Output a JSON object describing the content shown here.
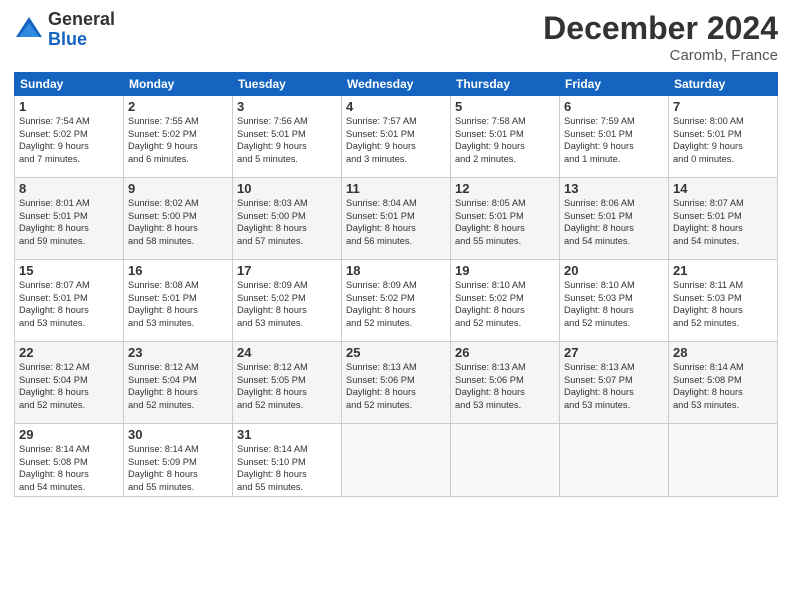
{
  "logo": {
    "general": "General",
    "blue": "Blue"
  },
  "header": {
    "month": "December 2024",
    "location": "Caromb, France"
  },
  "days": [
    "Sunday",
    "Monday",
    "Tuesday",
    "Wednesday",
    "Thursday",
    "Friday",
    "Saturday"
  ],
  "rows": [
    [
      {
        "num": "1",
        "lines": [
          "Sunrise: 7:54 AM",
          "Sunset: 5:02 PM",
          "Daylight: 9 hours",
          "and 7 minutes."
        ]
      },
      {
        "num": "2",
        "lines": [
          "Sunrise: 7:55 AM",
          "Sunset: 5:02 PM",
          "Daylight: 9 hours",
          "and 6 minutes."
        ]
      },
      {
        "num": "3",
        "lines": [
          "Sunrise: 7:56 AM",
          "Sunset: 5:01 PM",
          "Daylight: 9 hours",
          "and 5 minutes."
        ]
      },
      {
        "num": "4",
        "lines": [
          "Sunrise: 7:57 AM",
          "Sunset: 5:01 PM",
          "Daylight: 9 hours",
          "and 3 minutes."
        ]
      },
      {
        "num": "5",
        "lines": [
          "Sunrise: 7:58 AM",
          "Sunset: 5:01 PM",
          "Daylight: 9 hours",
          "and 2 minutes."
        ]
      },
      {
        "num": "6",
        "lines": [
          "Sunrise: 7:59 AM",
          "Sunset: 5:01 PM",
          "Daylight: 9 hours",
          "and 1 minute."
        ]
      },
      {
        "num": "7",
        "lines": [
          "Sunrise: 8:00 AM",
          "Sunset: 5:01 PM",
          "Daylight: 9 hours",
          "and 0 minutes."
        ]
      }
    ],
    [
      {
        "num": "8",
        "lines": [
          "Sunrise: 8:01 AM",
          "Sunset: 5:01 PM",
          "Daylight: 8 hours",
          "and 59 minutes."
        ]
      },
      {
        "num": "9",
        "lines": [
          "Sunrise: 8:02 AM",
          "Sunset: 5:00 PM",
          "Daylight: 8 hours",
          "and 58 minutes."
        ]
      },
      {
        "num": "10",
        "lines": [
          "Sunrise: 8:03 AM",
          "Sunset: 5:00 PM",
          "Daylight: 8 hours",
          "and 57 minutes."
        ]
      },
      {
        "num": "11",
        "lines": [
          "Sunrise: 8:04 AM",
          "Sunset: 5:01 PM",
          "Daylight: 8 hours",
          "and 56 minutes."
        ]
      },
      {
        "num": "12",
        "lines": [
          "Sunrise: 8:05 AM",
          "Sunset: 5:01 PM",
          "Daylight: 8 hours",
          "and 55 minutes."
        ]
      },
      {
        "num": "13",
        "lines": [
          "Sunrise: 8:06 AM",
          "Sunset: 5:01 PM",
          "Daylight: 8 hours",
          "and 54 minutes."
        ]
      },
      {
        "num": "14",
        "lines": [
          "Sunrise: 8:07 AM",
          "Sunset: 5:01 PM",
          "Daylight: 8 hours",
          "and 54 minutes."
        ]
      }
    ],
    [
      {
        "num": "15",
        "lines": [
          "Sunrise: 8:07 AM",
          "Sunset: 5:01 PM",
          "Daylight: 8 hours",
          "and 53 minutes."
        ]
      },
      {
        "num": "16",
        "lines": [
          "Sunrise: 8:08 AM",
          "Sunset: 5:01 PM",
          "Daylight: 8 hours",
          "and 53 minutes."
        ]
      },
      {
        "num": "17",
        "lines": [
          "Sunrise: 8:09 AM",
          "Sunset: 5:02 PM",
          "Daylight: 8 hours",
          "and 53 minutes."
        ]
      },
      {
        "num": "18",
        "lines": [
          "Sunrise: 8:09 AM",
          "Sunset: 5:02 PM",
          "Daylight: 8 hours",
          "and 52 minutes."
        ]
      },
      {
        "num": "19",
        "lines": [
          "Sunrise: 8:10 AM",
          "Sunset: 5:02 PM",
          "Daylight: 8 hours",
          "and 52 minutes."
        ]
      },
      {
        "num": "20",
        "lines": [
          "Sunrise: 8:10 AM",
          "Sunset: 5:03 PM",
          "Daylight: 8 hours",
          "and 52 minutes."
        ]
      },
      {
        "num": "21",
        "lines": [
          "Sunrise: 8:11 AM",
          "Sunset: 5:03 PM",
          "Daylight: 8 hours",
          "and 52 minutes."
        ]
      }
    ],
    [
      {
        "num": "22",
        "lines": [
          "Sunrise: 8:12 AM",
          "Sunset: 5:04 PM",
          "Daylight: 8 hours",
          "and 52 minutes."
        ]
      },
      {
        "num": "23",
        "lines": [
          "Sunrise: 8:12 AM",
          "Sunset: 5:04 PM",
          "Daylight: 8 hours",
          "and 52 minutes."
        ]
      },
      {
        "num": "24",
        "lines": [
          "Sunrise: 8:12 AM",
          "Sunset: 5:05 PM",
          "Daylight: 8 hours",
          "and 52 minutes."
        ]
      },
      {
        "num": "25",
        "lines": [
          "Sunrise: 8:13 AM",
          "Sunset: 5:06 PM",
          "Daylight: 8 hours",
          "and 52 minutes."
        ]
      },
      {
        "num": "26",
        "lines": [
          "Sunrise: 8:13 AM",
          "Sunset: 5:06 PM",
          "Daylight: 8 hours",
          "and 53 minutes."
        ]
      },
      {
        "num": "27",
        "lines": [
          "Sunrise: 8:13 AM",
          "Sunset: 5:07 PM",
          "Daylight: 8 hours",
          "and 53 minutes."
        ]
      },
      {
        "num": "28",
        "lines": [
          "Sunrise: 8:14 AM",
          "Sunset: 5:08 PM",
          "Daylight: 8 hours",
          "and 53 minutes."
        ]
      }
    ],
    [
      {
        "num": "29",
        "lines": [
          "Sunrise: 8:14 AM",
          "Sunset: 5:08 PM",
          "Daylight: 8 hours",
          "and 54 minutes."
        ]
      },
      {
        "num": "30",
        "lines": [
          "Sunrise: 8:14 AM",
          "Sunset: 5:09 PM",
          "Daylight: 8 hours",
          "and 55 minutes."
        ]
      },
      {
        "num": "31",
        "lines": [
          "Sunrise: 8:14 AM",
          "Sunset: 5:10 PM",
          "Daylight: 8 hours",
          "and 55 minutes."
        ]
      },
      null,
      null,
      null,
      null
    ]
  ]
}
